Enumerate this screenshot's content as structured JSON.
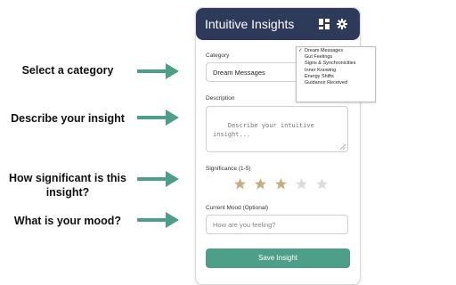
{
  "callouts": [
    {
      "text": "Select a category"
    },
    {
      "text": "Describe your insight"
    },
    {
      "text": "How significant is this insight?"
    },
    {
      "text": "What is your mood?"
    }
  ],
  "header": {
    "title": "Intuitive Insights",
    "icons": [
      "dashboard-icon",
      "gear-icon"
    ],
    "background": "#2e3a59"
  },
  "form": {
    "category_label": "Category",
    "category_value": "Dream Messages",
    "description_label": "Description",
    "description_placeholder": "Describe your intuitive\ninsight...",
    "significance_label": "Significance (1-5)",
    "significance_value": 3,
    "significance_max": 5,
    "mood_label": "Current Mood (Optional)",
    "mood_placeholder": "How are you feeling?",
    "save_label": "Save Insight"
  },
  "dropdown": {
    "selected": "Dream Messages",
    "options": [
      "Dream Messages",
      "Gut Feelings",
      "Signs & Synchronicities",
      "Inner Knowing",
      "Energy Shifts",
      "Guidance Received"
    ]
  },
  "colors": {
    "accent": "#4e9f89",
    "star_filled": "#c8ad7f",
    "star_empty": "#dcdcdc",
    "arrow": "#4e9f89"
  }
}
